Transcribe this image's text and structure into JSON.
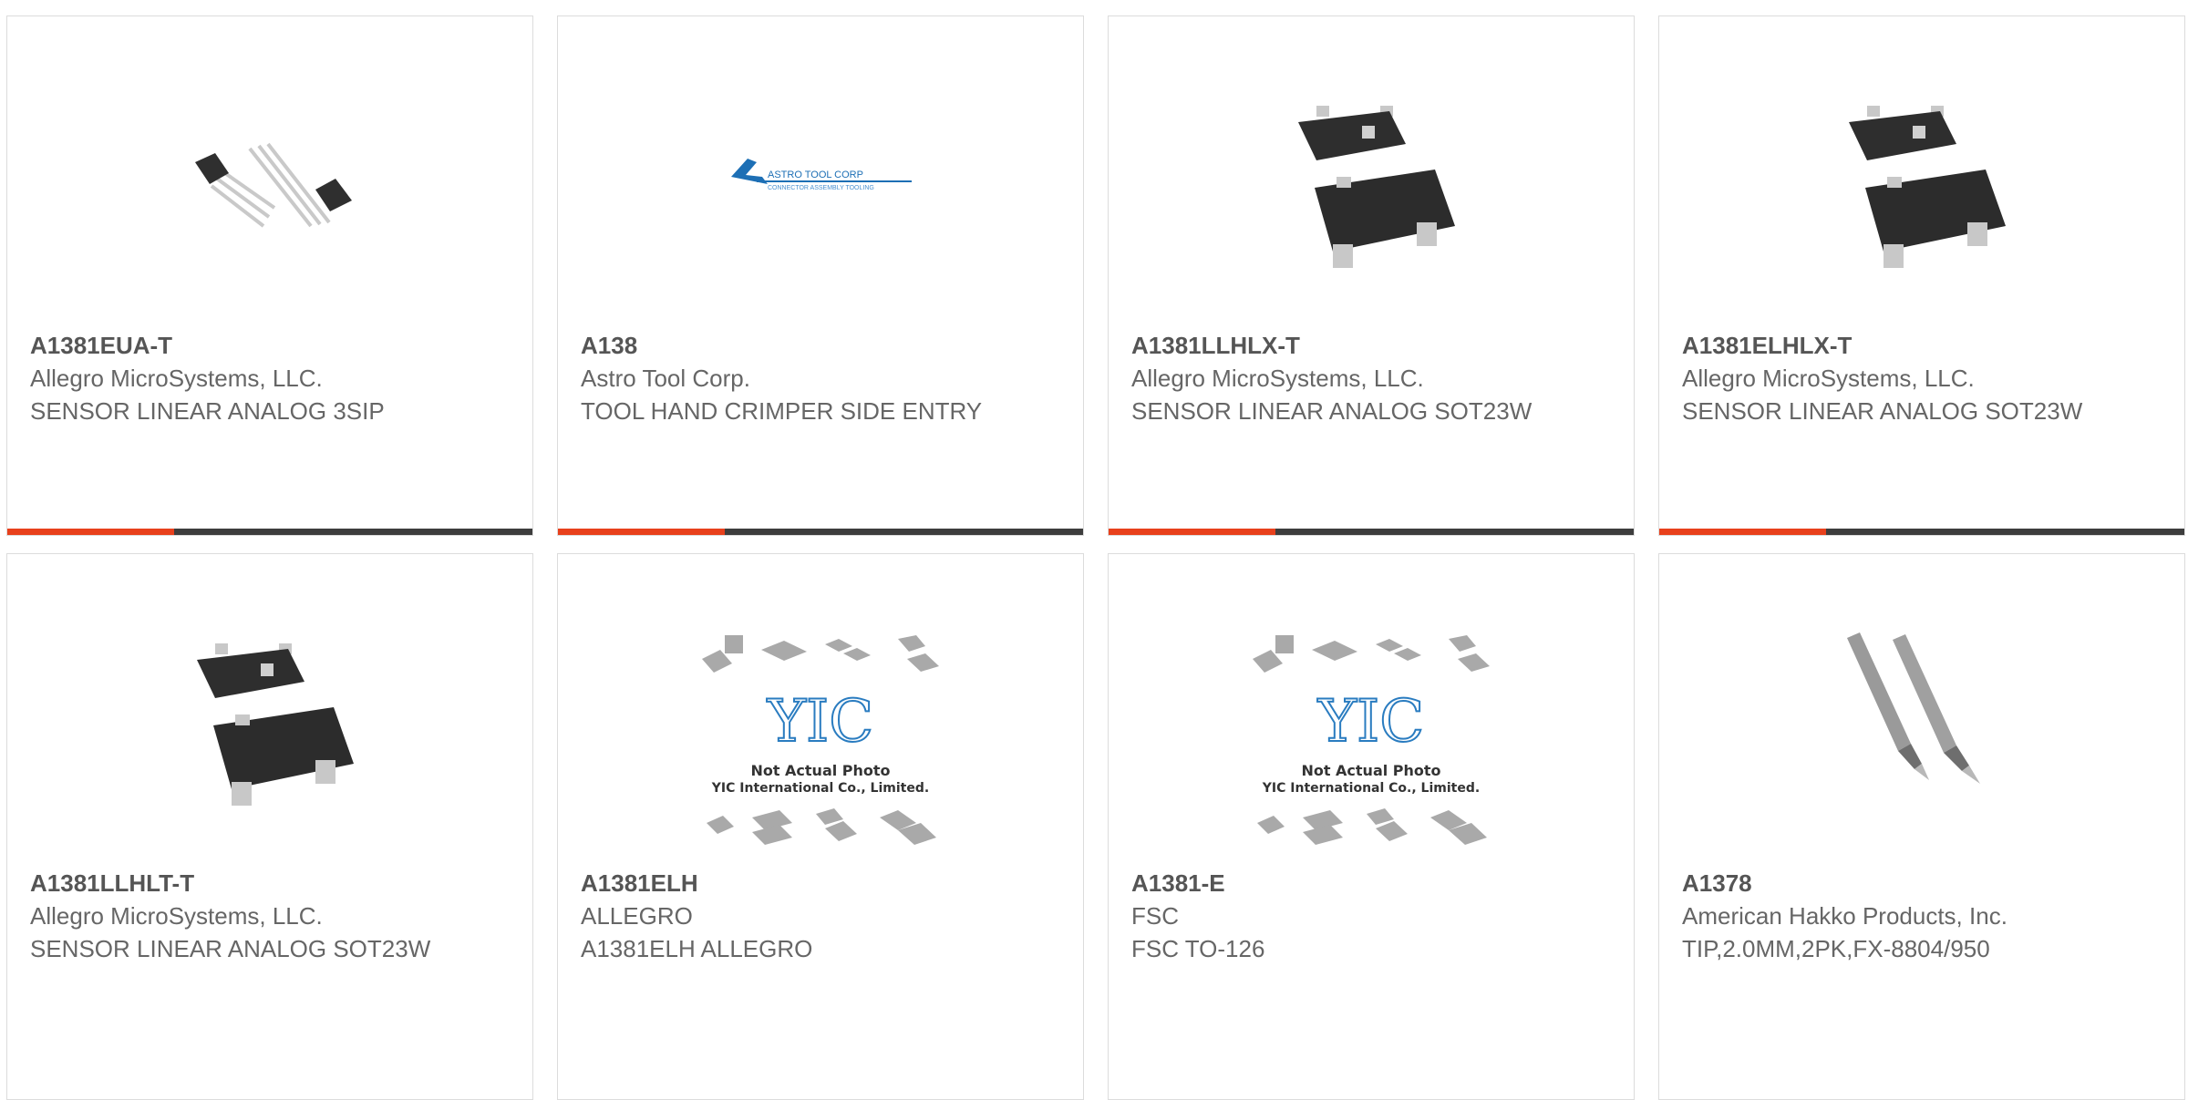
{
  "products": [
    {
      "part_number": "A1381EUA-T",
      "manufacturer": "Allegro MicroSystems, LLC.",
      "description": "SENSOR LINEAR ANALOG 3SIP",
      "image": "to92-3sip-sensor-icon"
    },
    {
      "part_number": "A138",
      "manufacturer": "Astro Tool Corp.",
      "description": "TOOL HAND CRIMPER SIDE ENTRY",
      "image": "astro-tool-corp-logo",
      "logo_text": "ASTRO TOOL CORP",
      "logo_subtext": "CONNECTOR ASSEMBLY TOOLING"
    },
    {
      "part_number": "A1381LLHLX-T",
      "manufacturer": "Allegro MicroSystems, LLC.",
      "description": "SENSOR LINEAR ANALOG SOT23W",
      "image": "sot23w-package-icon"
    },
    {
      "part_number": "A1381ELHLX-T",
      "manufacturer": "Allegro MicroSystems, LLC.",
      "description": "SENSOR LINEAR ANALOG SOT23W",
      "image": "sot23w-package-icon"
    },
    {
      "part_number": "A1381LLHLT-T",
      "manufacturer": "Allegro MicroSystems, LLC.",
      "description": "SENSOR LINEAR ANALOG SOT23W",
      "image": "sot23w-package-icon"
    },
    {
      "part_number": "A1381ELH",
      "manufacturer": "ALLEGRO",
      "description": "A1381ELH ALLEGRO",
      "image": "yic-placeholder-icon",
      "placeholder_line1": "Not Actual Photo",
      "placeholder_line2": "YIC International Co., Limited."
    },
    {
      "part_number": "A1381-E",
      "manufacturer": "FSC",
      "description": "FSC TO-126",
      "image": "yic-placeholder-icon",
      "placeholder_line1": "Not Actual Photo",
      "placeholder_line2": "YIC International Co., Limited."
    },
    {
      "part_number": "A1378",
      "manufacturer": "American Hakko Products, Inc.",
      "description": "TIP,2.0MM,2PK,FX-8804/950",
      "image": "soldering-tips-icon"
    }
  ],
  "colors": {
    "accent": "#e8401c",
    "bar": "#3d3d3d",
    "text": "#666666",
    "border": "#dcdcdc"
  }
}
